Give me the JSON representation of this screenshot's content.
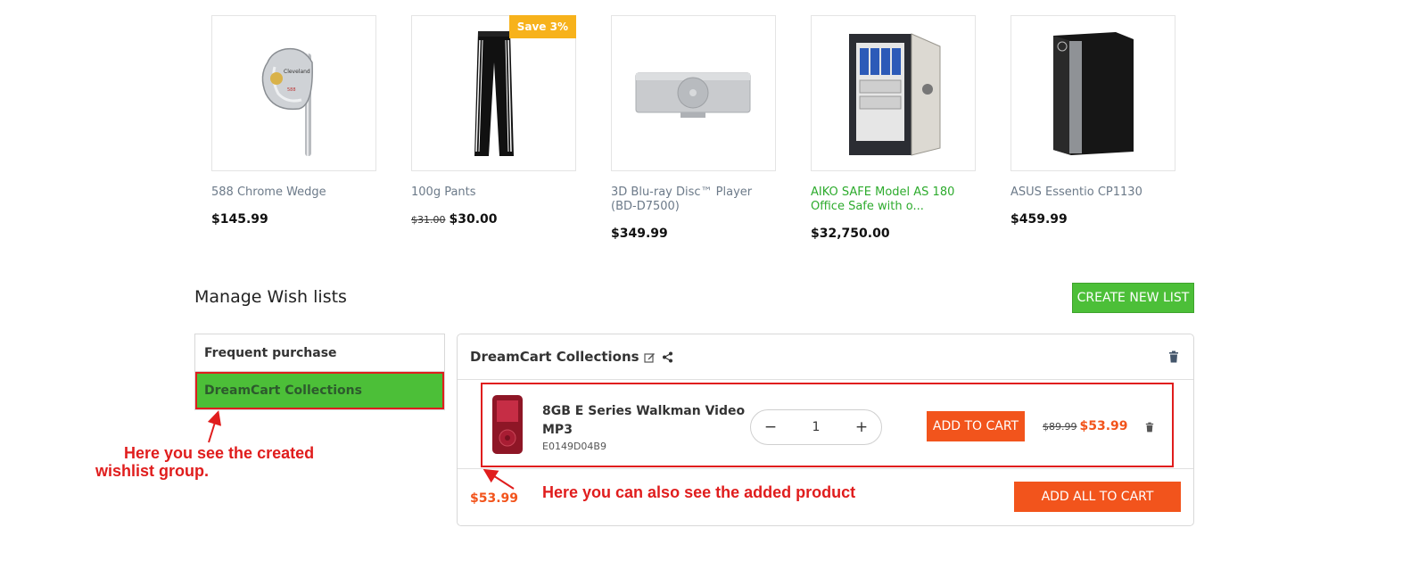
{
  "products": [
    {
      "name": "588 Chrome Wedge",
      "price": "$145.99",
      "old_price": "",
      "badge": "",
      "image_icon": "golf-wedge-icon"
    },
    {
      "name": "100g Pants",
      "price": "$30.00",
      "old_price": "$31.00",
      "badge": "Save 3%",
      "image_icon": "pants-icon"
    },
    {
      "name": "3D Blu-ray Disc™ Player (BD-D7500)",
      "price": "$349.99",
      "old_price": "",
      "badge": "",
      "image_icon": "bluray-player-icon"
    },
    {
      "name": "AIKO SAFE Model AS 180 Office Safe with o...",
      "price": "$32,750.00",
      "old_price": "",
      "badge": "",
      "image_icon": "office-safe-icon"
    },
    {
      "name": "ASUS Essentio CP1130",
      "price": "$459.99",
      "old_price": "",
      "badge": "",
      "image_icon": "desktop-tower-icon"
    }
  ],
  "wishlists": {
    "title": "Manage Wish lists",
    "create_label": "CREATE NEW LIST",
    "lists": [
      {
        "label": "Frequent purchase",
        "active": false
      },
      {
        "label": "DreamCart Collections",
        "active": true
      }
    ],
    "panel": {
      "title": "DreamCart Collections",
      "item": {
        "name": "8GB E Series Walkman Video MP3",
        "sku": "E0149D04B9",
        "qty": "1",
        "qty_minus": "−",
        "qty_plus": "+",
        "add_label": "ADD TO CART",
        "old_price": "$89.99",
        "price": "$53.99",
        "image_icon": "walkman-icon"
      },
      "total": "$53.99",
      "add_all_label": "ADD ALL TO CART"
    }
  },
  "annotations": {
    "group_line1": "Here you see the created",
    "group_line2": "wishlist group.",
    "product_note": "Here you can also see the added product"
  },
  "colors": {
    "accent_green": "#4cbf38",
    "accent_orange": "#f2541c",
    "badge_yellow": "#f7b21b",
    "annotation_red": "#e01d1d"
  }
}
